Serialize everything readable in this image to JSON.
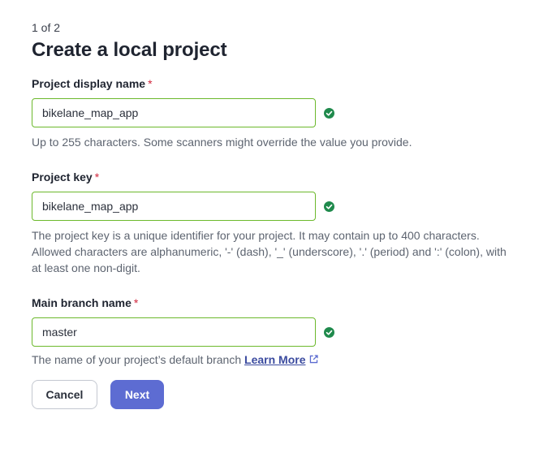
{
  "step_indicator": "1 of 2",
  "page_title": "Create a local project",
  "required_marker": "*",
  "fields": {
    "display_name": {
      "label": "Project display name",
      "value": "bikelane_map_app",
      "help": "Up to 255 characters. Some scanners might override the value you provide."
    },
    "project_key": {
      "label": "Project key",
      "value": "bikelane_map_app",
      "help": "The project key is a unique identifier for your project. It may contain up to 400 characters. Allowed characters are alphanumeric, '-' (dash), '_' (underscore), '.' (period) and ':' (colon), with at least one non-digit."
    },
    "main_branch": {
      "label": "Main branch name",
      "value": "master",
      "help": "The name of your project’s default branch",
      "link_text": "Learn More"
    }
  },
  "buttons": {
    "cancel": "Cancel",
    "next": "Next"
  },
  "icons": {
    "valid": "check-circle-icon",
    "external_link": "external-link-icon"
  },
  "colors": {
    "valid_green": "#1f8a4c",
    "input_border_valid": "#6cb92c",
    "primary": "#5d6cd2",
    "required": "#d0263c",
    "link": "#3b4b9f"
  }
}
